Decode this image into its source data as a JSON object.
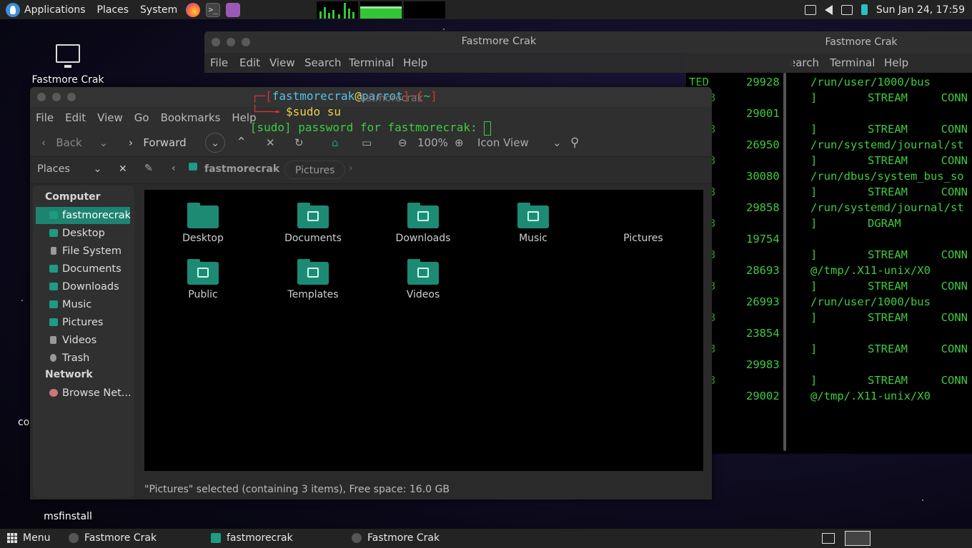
{
  "top_panel": {
    "applications": "Applications",
    "places": "Places",
    "system": "System",
    "clock": "Sun Jan 24, 17:59"
  },
  "desktop": {
    "icon1": "Fastmore Crak",
    "icon2": "msfinstall",
    "icon3_partial": "co"
  },
  "term_back": {
    "title": "Fastmore Crak",
    "menu": [
      "earch",
      "Terminal",
      "Help"
    ],
    "rows": [
      {
        "c1": "TED",
        "c2": "29928",
        "c3": "/run/user/1000/bus",
        "c4": ""
      },
      {
        "c1": "x  3",
        "c2": "",
        "c3": "]",
        "c4": "STREAM     CONN"
      },
      {
        "c1": "",
        "c2": "29001",
        "c3": "",
        "c4": ""
      },
      {
        "c1": "x  3",
        "c2": "",
        "c3": "]",
        "c4": "STREAM     CONN"
      },
      {
        "c1": "",
        "c2": "26950",
        "c3": "/run/systemd/journal/st",
        "c4": ""
      },
      {
        "c1": "x  3",
        "c2": "",
        "c3": "]",
        "c4": "STREAM     CONN"
      },
      {
        "c1": "",
        "c2": "30080",
        "c3": "/run/dbus/system_bus_so",
        "c4": ""
      },
      {
        "c1": "x  3",
        "c2": "",
        "c3": "]",
        "c4": "STREAM     CONN"
      },
      {
        "c1": "",
        "c2": "29858",
        "c3": "/run/systemd/journal/st",
        "c4": ""
      },
      {
        "c1": "x  3",
        "c2": "",
        "c3": "]",
        "c4": "DGRAM"
      },
      {
        "c1": "",
        "c2": "19754",
        "c3": "",
        "c4": ""
      },
      {
        "c1": "x  3",
        "c2": "",
        "c3": "]",
        "c4": "STREAM     CONN"
      },
      {
        "c1": "",
        "c2": "28693",
        "c3": "@/tmp/.X11-unix/X0",
        "c4": ""
      },
      {
        "c1": "x  3",
        "c2": "",
        "c3": "]",
        "c4": "STREAM     CONN"
      },
      {
        "c1": "",
        "c2": "26993",
        "c3": "/run/user/1000/bus",
        "c4": ""
      },
      {
        "c1": "x  3",
        "c2": "",
        "c3": "]",
        "c4": "STREAM     CONN"
      },
      {
        "c1": "",
        "c2": "23854",
        "c3": "",
        "c4": ""
      },
      {
        "c1": "x  3",
        "c2": "",
        "c3": "]",
        "c4": "STREAM     CONN"
      },
      {
        "c1": "",
        "c2": "29983",
        "c3": "",
        "c4": ""
      },
      {
        "c1": "x  3",
        "c2": "",
        "c3": "]",
        "c4": "STREAM     CONN"
      },
      {
        "c1": "",
        "c2": "29002",
        "c3": "@/tmp/.X11-unix/X0",
        "c4": ""
      }
    ]
  },
  "term_front": {
    "title": "Fastmore Crak",
    "menu": [
      "File",
      "Edit",
      "View",
      "Search",
      "Terminal",
      "Help"
    ],
    "user": "fastmorecrak",
    "at": "@",
    "host": "parrot",
    "dir": "~",
    "command": "$sudo su",
    "ghost_title": "fastmorecrak",
    "password_prompt": "[sudo] password for fastmorecrak: "
  },
  "file_manager": {
    "menu": [
      "File",
      "Edit",
      "View",
      "Go",
      "Bookmarks",
      "Help"
    ],
    "back": "Back",
    "forward": "Forward",
    "zoom": "100%",
    "view_mode": "Icon View",
    "places_label": "Places",
    "path": [
      "fastmorecrak",
      "Pictures"
    ],
    "sidebar": {
      "computer_head": "Computer",
      "items": [
        "fastmorecrak",
        "Desktop",
        "File System",
        "Documents",
        "Downloads",
        "Music",
        "Pictures",
        "Videos",
        "Trash"
      ],
      "network_head": "Network",
      "network_items": [
        "Browse Net..."
      ]
    },
    "folders": [
      "Desktop",
      "Documents",
      "Downloads",
      "Music",
      "Pictures",
      "Public",
      "Templates",
      "Videos"
    ],
    "status": "\"Pictures\" selected (containing 3 items), Free space: 16.0 GB"
  },
  "bottom_panel": {
    "menu": "Menu",
    "tasks": [
      "Fastmore Crak",
      "fastmorecrak",
      "Fastmore Crak"
    ]
  }
}
